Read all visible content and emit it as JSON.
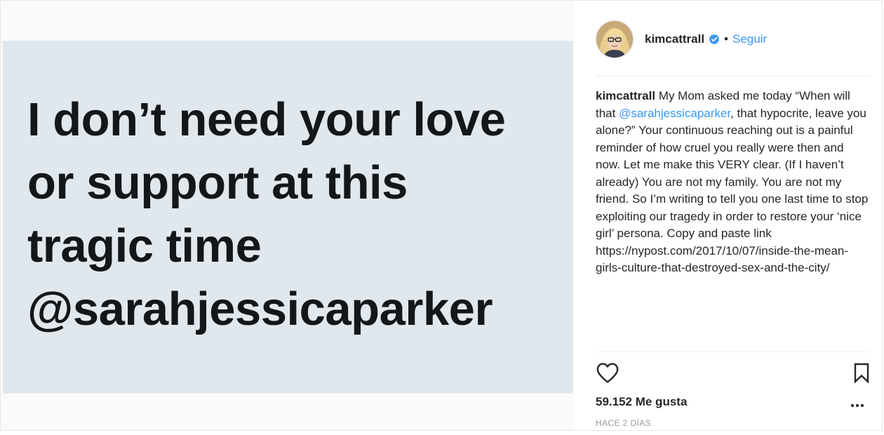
{
  "media": {
    "quote_text": "I don’t need your love\nor support at this\ntragic time\n@sarahjessicaparker",
    "card_background": "#e1e8ed",
    "text_color": "#14171a"
  },
  "header": {
    "username": "kimcattrall",
    "verified_icon": "verified-badge-icon",
    "separator": "•",
    "follow_label": "Seguir",
    "accent_color": "#3897f0"
  },
  "caption": {
    "username": "kimcattrall",
    "text_before_mention": "My Mom asked me today “When will that",
    "mention": "@sarahjessicaparker",
    "text_after_mention": ", that hypocrite, leave you alone?” Your continuous reaching out is a painful reminder of how cruel you really were then and now. Let me make this VERY clear. (If I haven’t already) You are not my family. You are not my friend. So I’m writing to tell you one last time to stop exploiting our tragedy in order to restore your ‘nice girl’ persona. Copy and paste link https://nypost.com/2017/10/07/inside-the-mean-girls-culture-that-destroyed-sex-and-the-city/"
  },
  "actions": {
    "like_icon": "heart-icon",
    "bookmark_icon": "bookmark-icon",
    "more_icon": "more-options-icon"
  },
  "likes": {
    "text": "59.152 Me gusta"
  },
  "timestamp": {
    "text": "HACE 2 DÍAS"
  }
}
